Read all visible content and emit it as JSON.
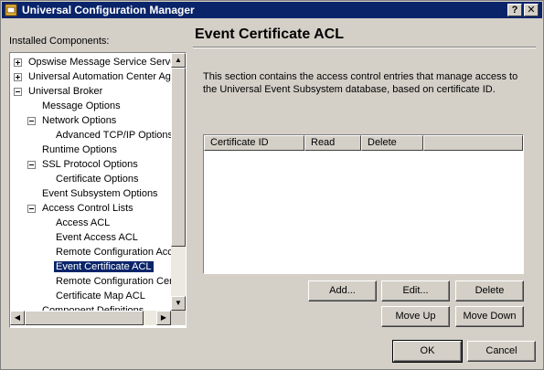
{
  "window": {
    "title": "Universal Configuration Manager",
    "help_label": "?",
    "close_label": "✕"
  },
  "sidebar": {
    "label": "Installed Components:",
    "tree": [
      {
        "label": "Opswise Message Service Server",
        "level": 0,
        "expander": "plus"
      },
      {
        "label": "Universal Automation Center Agent",
        "level": 0,
        "expander": "plus"
      },
      {
        "label": "Universal Broker",
        "level": 0,
        "expander": "minus"
      },
      {
        "label": "Message Options",
        "level": 1,
        "expander": "none"
      },
      {
        "label": "Network Options",
        "level": 1,
        "expander": "minus"
      },
      {
        "label": "Advanced TCP/IP Options",
        "level": 2,
        "expander": "none"
      },
      {
        "label": "Runtime Options",
        "level": 1,
        "expander": "none"
      },
      {
        "label": "SSL Protocol Options",
        "level": 1,
        "expander": "minus"
      },
      {
        "label": "Certificate Options",
        "level": 2,
        "expander": "none"
      },
      {
        "label": "Event Subsystem Options",
        "level": 1,
        "expander": "none"
      },
      {
        "label": "Access Control Lists",
        "level": 1,
        "expander": "minus"
      },
      {
        "label": "Access ACL",
        "level": 2,
        "expander": "none"
      },
      {
        "label": "Event Access ACL",
        "level": 2,
        "expander": "none"
      },
      {
        "label": "Remote Configuration Access ACL",
        "level": 2,
        "expander": "none"
      },
      {
        "label": "Event Certificate ACL",
        "level": 2,
        "expander": "none",
        "selected": true
      },
      {
        "label": "Remote Configuration Certificate ACL",
        "level": 2,
        "expander": "none"
      },
      {
        "label": "Certificate Map ACL",
        "level": 2,
        "expander": "none"
      },
      {
        "label": "Component Definitions",
        "level": 1,
        "expander": "none"
      }
    ],
    "scroll_up": "▲",
    "scroll_down": "▼",
    "scroll_left": "◀",
    "scroll_right": "▶"
  },
  "main": {
    "title": "Event Certificate ACL",
    "description": "This section contains the access control entries that manage access to the Universal Event Subsystem database, based on certificate ID.",
    "table": {
      "columns": [
        "Certificate ID",
        "Read",
        "Delete",
        ""
      ],
      "rows": []
    },
    "buttons": {
      "add": "Add...",
      "edit": "Edit...",
      "delete": "Delete",
      "move_up": "Move Up",
      "move_down": "Move Down"
    }
  },
  "footer": {
    "ok": "OK",
    "cancel": "Cancel"
  }
}
